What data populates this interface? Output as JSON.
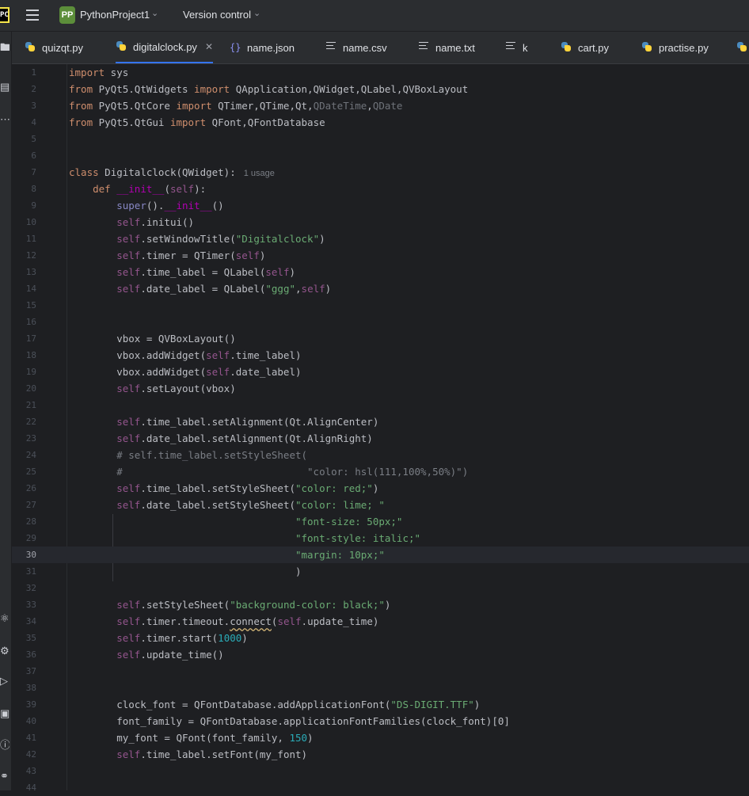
{
  "titlebar": {
    "project_badge": "PP",
    "project_name": "PythonProject1",
    "vcs_label": "Version control"
  },
  "tabs": [
    {
      "label": "quizqt.py",
      "icon": "python-file-icon"
    },
    {
      "label": "digitalclock.py",
      "icon": "python-file-icon",
      "active": true
    },
    {
      "label": "name.json",
      "icon": "json-file-icon"
    },
    {
      "label": "name.csv",
      "icon": "text-file-icon"
    },
    {
      "label": "name.txt",
      "icon": "text-file-icon"
    },
    {
      "label": "k",
      "icon": "text-file-icon"
    },
    {
      "label": "cart.py",
      "icon": "python-file-icon"
    },
    {
      "label": "practise.py",
      "icon": "python-file-icon"
    }
  ],
  "editor": {
    "current_line": 30,
    "usage_hint": "1 usage",
    "lines": [
      {
        "n": "1",
        "t": "import sys"
      },
      {
        "n": "2",
        "t": "from PyQt5.QtWidgets import QApplication,QWidget,QLabel,QVBoxLayout"
      },
      {
        "n": "3",
        "t": "from PyQt5.QtCore import QTimer,QTime,Qt,QDateTime,QDate"
      },
      {
        "n": "4",
        "t": "from PyQt5.QtGui import QFont,QFontDatabase"
      },
      {
        "n": "5",
        "t": ""
      },
      {
        "n": "6",
        "t": ""
      },
      {
        "n": "7",
        "t": "class Digitalclock(QWidget):"
      },
      {
        "n": "8",
        "t": "    def __init__(self):"
      },
      {
        "n": "9",
        "t": "        super().__init__()"
      },
      {
        "n": "10",
        "t": "        self.initui()"
      },
      {
        "n": "11",
        "t": "        self.setWindowTitle(\"Digitalclock\")"
      },
      {
        "n": "12",
        "t": "        self.timer = QTimer(self)"
      },
      {
        "n": "13",
        "t": "        self.time_label = QLabel(self)"
      },
      {
        "n": "14",
        "t": "        self.date_label = QLabel(\"ggg\",self)"
      },
      {
        "n": "15",
        "t": ""
      },
      {
        "n": "16",
        "t": ""
      },
      {
        "n": "17",
        "t": "        vbox = QVBoxLayout()"
      },
      {
        "n": "18",
        "t": "        vbox.addWidget(self.time_label)"
      },
      {
        "n": "19",
        "t": "        vbox.addWidget(self.date_label)"
      },
      {
        "n": "20",
        "t": "        self.setLayout(vbox)"
      },
      {
        "n": "21",
        "t": ""
      },
      {
        "n": "22",
        "t": "        self.time_label.setAlignment(Qt.AlignCenter)"
      },
      {
        "n": "23",
        "t": "        self.date_label.setAlignment(Qt.AlignRight)"
      },
      {
        "n": "24",
        "t": "        # self.time_label.setStyleSheet("
      },
      {
        "n": "25",
        "t": "        #                               \"color: hsl(111,100%,50%)\")"
      },
      {
        "n": "26",
        "t": "        self.time_label.setStyleSheet(\"color: red;\")"
      },
      {
        "n": "27",
        "t": "        self.date_label.setStyleSheet(\"color: lime; \""
      },
      {
        "n": "28",
        "t": "                                      \"font-size: 50px;\""
      },
      {
        "n": "29",
        "t": "                                      \"font-style: italic;\""
      },
      {
        "n": "30",
        "t": "                                      \"margin: 10px;\""
      },
      {
        "n": "31",
        "t": "                                      )"
      },
      {
        "n": "32",
        "t": ""
      },
      {
        "n": "33",
        "t": "        self.setStyleSheet(\"background-color: black;\")"
      },
      {
        "n": "34",
        "t": "        self.timer.timeout.connect(self.update_time)"
      },
      {
        "n": "35",
        "t": "        self.timer.start(1000)"
      },
      {
        "n": "36",
        "t": "        self.update_time()"
      },
      {
        "n": "37",
        "t": ""
      },
      {
        "n": "38",
        "t": ""
      },
      {
        "n": "39",
        "t": "        clock_font = QFontDatabase.addApplicationFont(\"DS-DIGIT.TTF\")"
      },
      {
        "n": "40",
        "t": "        font_family = QFontDatabase.applicationFontFamilies(clock_font)[0]"
      },
      {
        "n": "41",
        "t": "        my_font = QFont(font_family, 150)"
      },
      {
        "n": "42",
        "t": "        self.time_label.setFont(my_font)"
      },
      {
        "n": "43",
        "t": ""
      },
      {
        "n": "44",
        "t": ""
      }
    ]
  }
}
